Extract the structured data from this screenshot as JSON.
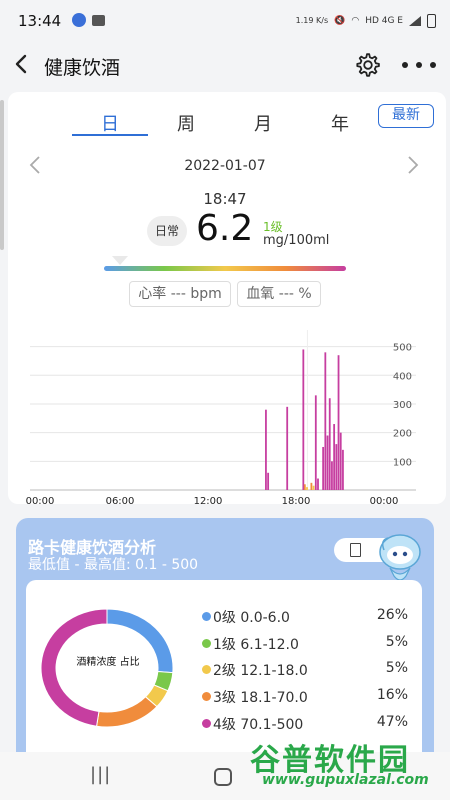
{
  "status_bar": {
    "time": "13:44",
    "net_speed": "1.19 K/s",
    "network": "HD 4G E",
    "icons": [
      "app-notification-icon",
      "message-icon",
      "mute-icon",
      "wifi-icon",
      "signal-icon",
      "battery-icon"
    ]
  },
  "app_bar": {
    "title": "健康饮酒",
    "icons": [
      "back-icon",
      "settings-gear-icon",
      "more-dots-icon"
    ]
  },
  "tabs": [
    {
      "label": "日",
      "active": true
    },
    {
      "label": "周",
      "active": false
    },
    {
      "label": "月",
      "active": false
    },
    {
      "label": "年",
      "active": false
    }
  ],
  "latest_button": "最新",
  "date": "2022-01-07",
  "measurement": {
    "time": "18:47",
    "mode": "日常",
    "value": "6.2",
    "level": "1级",
    "unit": "mg/100ml"
  },
  "heart_rate": "心率 --- bpm",
  "blood_oxygen": "血氧 --- %",
  "colors": {
    "accent": "#2f6fd6",
    "level0": "#5b9be8",
    "level1": "#7ac84a",
    "level2": "#f2c94c",
    "level3": "#f08c3c",
    "level4": "#c63ea0",
    "card_bg": "#a9c6f0"
  },
  "chart_data": {
    "type": "bar",
    "x_ticks": [
      "00:00",
      "06:00",
      "12:00",
      "18:00",
      "00:00"
    ],
    "y_ticks": [
      100,
      200,
      300,
      400,
      500
    ],
    "ylim": [
      0,
      530
    ],
    "xlim_hours": [
      0,
      24
    ],
    "grid": true,
    "bars": [
      {
        "t": 15.95,
        "v": 280,
        "level": 4
      },
      {
        "t": 16.1,
        "v": 60,
        "level": 4
      },
      {
        "t": 17.4,
        "v": 290,
        "level": 4
      },
      {
        "t": 18.5,
        "v": 490,
        "level": 4
      },
      {
        "t": 18.6,
        "v": 20,
        "level": 3
      },
      {
        "t": 18.75,
        "v": 10,
        "level": 2
      },
      {
        "t": 19.05,
        "v": 25,
        "level": 3
      },
      {
        "t": 19.2,
        "v": 15,
        "level": 2
      },
      {
        "t": 19.35,
        "v": 330,
        "level": 4
      },
      {
        "t": 19.5,
        "v": 40,
        "level": 4
      },
      {
        "t": 19.85,
        "v": 150,
        "level": 4
      },
      {
        "t": 20.0,
        "v": 480,
        "level": 4
      },
      {
        "t": 20.15,
        "v": 190,
        "level": 4
      },
      {
        "t": 20.3,
        "v": 320,
        "level": 4
      },
      {
        "t": 20.45,
        "v": 100,
        "level": 4
      },
      {
        "t": 20.6,
        "v": 230,
        "level": 4
      },
      {
        "t": 20.75,
        "v": 160,
        "level": 4
      },
      {
        "t": 20.9,
        "v": 470,
        "level": 4
      },
      {
        "t": 21.05,
        "v": 200,
        "level": 4
      },
      {
        "t": 21.2,
        "v": 140,
        "level": 4
      }
    ]
  },
  "analysis": {
    "title": "路卡健康饮酒分析",
    "range": "最低值 - 最高值:  0.1 - 500",
    "donut_label": "酒精浓度 占比",
    "legend": [
      {
        "label": "0级 0.0-6.0",
        "pct": "26%",
        "value": 26,
        "color": "#5b9be8"
      },
      {
        "label": "1级 6.1-12.0",
        "pct": "5%",
        "value": 5,
        "color": "#7ac84a"
      },
      {
        "label": "2级 12.1-18.0",
        "pct": "5%",
        "value": 5,
        "color": "#f2c94c"
      },
      {
        "label": "3级 18.1-70.0",
        "pct": "16%",
        "value": 16,
        "color": "#f08c3c"
      },
      {
        "label": "4级 70.1-500",
        "pct": "47%",
        "value": 47,
        "color": "#c63ea0"
      }
    ]
  },
  "watermark": {
    "text": "谷普软件园",
    "url": "www.gupuxlazal.com"
  }
}
